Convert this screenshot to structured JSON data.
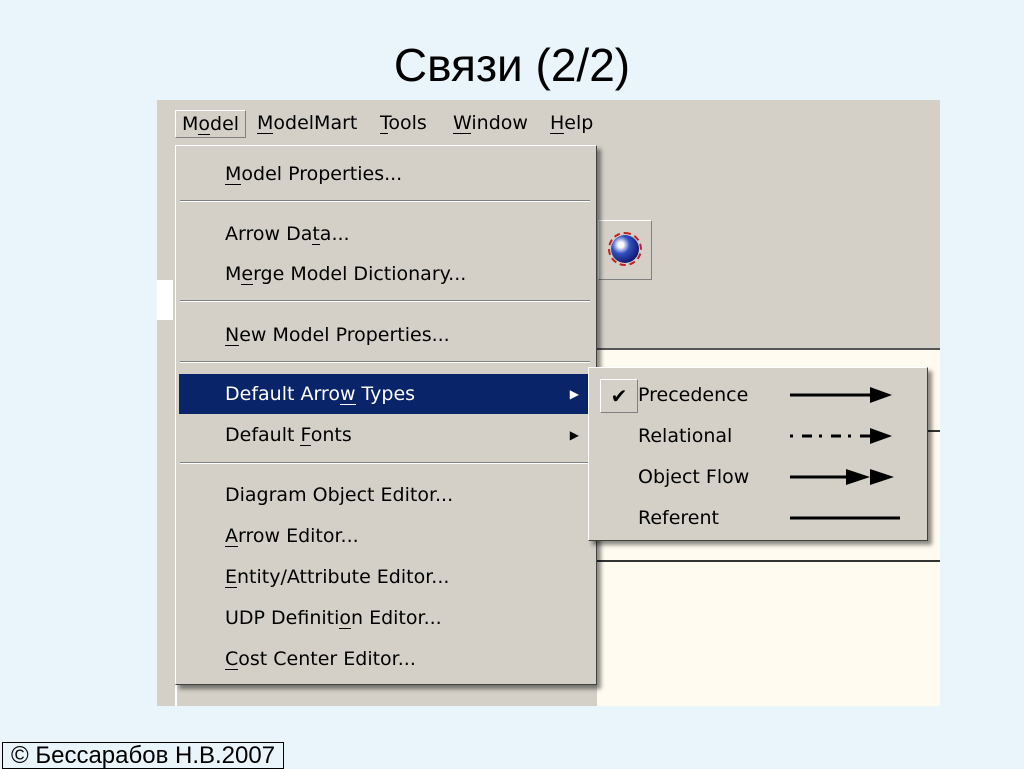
{
  "slide_title": "Связи (2/2)",
  "copyright": "© Бессарабов Н.В.2007",
  "menubar": [
    {
      "label": "Model",
      "u": 1
    },
    {
      "label": "ModelMart",
      "u": 0
    },
    {
      "label": "Tools",
      "u": 0
    },
    {
      "label": "Window",
      "u": 0
    },
    {
      "label": "Help",
      "u": 0
    }
  ],
  "model_menu": [
    {
      "label": "Model Properties...",
      "u": 0
    },
    {
      "label": "Arrow Data...",
      "u": 8
    },
    {
      "label": "Merge Model Dictionary...",
      "u": 1
    },
    {
      "label": "New Model Properties...",
      "u": 0
    },
    {
      "label": "Default Arrow Types",
      "u": 12,
      "submenu": true,
      "highlighted": true
    },
    {
      "label": "Default Fonts",
      "u": 8,
      "submenu": true
    },
    {
      "label": "Diagram Object Editor...",
      "u": -1
    },
    {
      "label": "Arrow Editor...",
      "u": 0
    },
    {
      "label": "Entity/Attribute Editor...",
      "u": 0
    },
    {
      "label": "UDP Definition Editor...",
      "u": 12
    },
    {
      "label": "Cost Center Editor...",
      "u": 0
    }
  ],
  "arrow_types": [
    {
      "label": "Precedence",
      "checked": true,
      "style": "solid-arrow"
    },
    {
      "label": "Relational",
      "checked": false,
      "style": "dashed-arrow"
    },
    {
      "label": "Object Flow",
      "checked": false,
      "style": "double-arrow"
    },
    {
      "label": "Referent",
      "checked": false,
      "style": "line"
    }
  ],
  "colors": {
    "highlight": "#0a246a",
    "menu_bg": "#d4d0c8",
    "slide_bg": "#eaf4fb"
  }
}
